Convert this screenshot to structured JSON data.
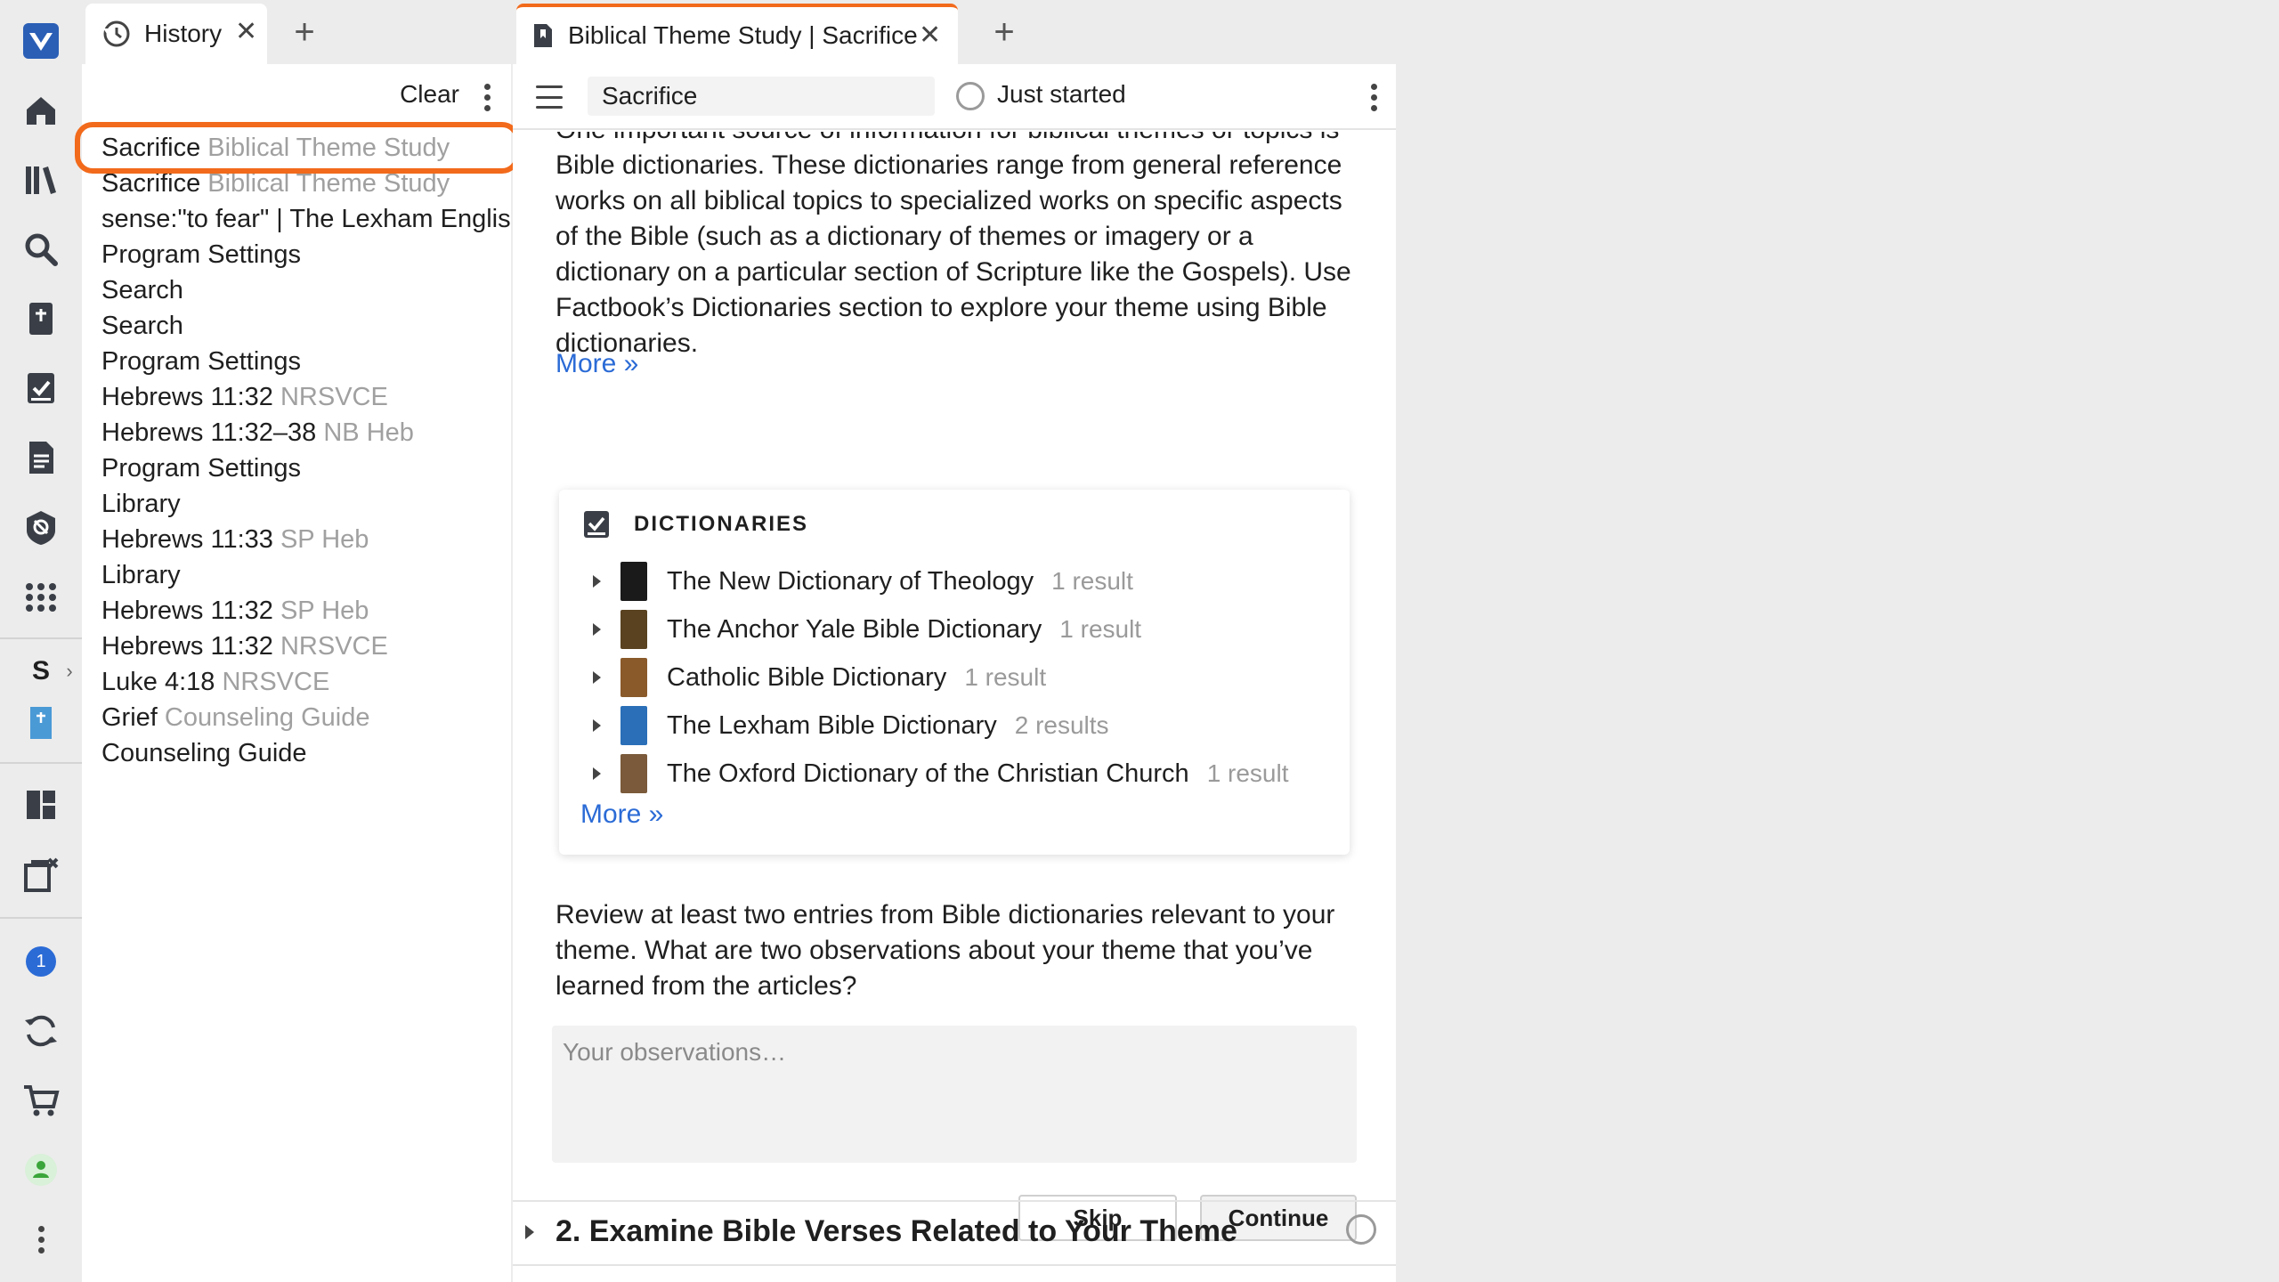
{
  "history_tab": {
    "label": "History",
    "close": "✕",
    "add": "+"
  },
  "history_toolbar": {
    "clear_label": "Clear"
  },
  "history_items": [
    {
      "title": "Sacrifice",
      "sub": "Biblical Theme Study"
    },
    {
      "title": "Sacrifice",
      "sub": "Biblical Theme Study"
    },
    {
      "title": "sense:\"to fear\" | The Lexham English",
      "sub": ""
    },
    {
      "title": "Program Settings",
      "sub": ""
    },
    {
      "title": "Search",
      "sub": ""
    },
    {
      "title": "Search",
      "sub": ""
    },
    {
      "title": "Program Settings",
      "sub": ""
    },
    {
      "title": "Hebrews 11:32",
      "sub": "NRSVCE"
    },
    {
      "title": "Hebrews 11:32–38",
      "sub": "NB Heb"
    },
    {
      "title": "Program Settings",
      "sub": ""
    },
    {
      "title": "Library",
      "sub": ""
    },
    {
      "title": "Hebrews 11:33",
      "sub": "SP Heb"
    },
    {
      "title": "Library",
      "sub": ""
    },
    {
      "title": "Hebrews 11:32",
      "sub": "SP Heb"
    },
    {
      "title": "Hebrews 11:32",
      "sub": "NRSVCE"
    },
    {
      "title": "Luke 4:18",
      "sub": "NRSVCE"
    },
    {
      "title": "Grief",
      "sub": "Counseling Guide"
    },
    {
      "title": "Counseling Guide",
      "sub": ""
    }
  ],
  "rail": {
    "shortcut_letter": "S",
    "notification_count": "1"
  },
  "doc_tab": {
    "label": "Biblical Theme Study | Sacrifice",
    "close": "✕",
    "add": "+"
  },
  "doc_toolbar": {
    "title_value": "Sacrifice",
    "status_label": "Just started"
  },
  "intro": {
    "cut_line": "One important source of information for biblical themes or topics is",
    "text": "Bible dictionaries. These dictionaries range from general reference works on all biblical topics to specialized works on specific aspects of the Bible (such as a dictionary of themes or imagery or a dictionary on a particular section of Scripture like the Gospels). Use Factbook’s Dictionaries section to explore your theme using Bible dictionaries.",
    "more": "More »"
  },
  "dictionaries": {
    "heading": "DICTIONARIES",
    "more": "More »",
    "items": [
      {
        "name": "The New Dictionary of Theology",
        "count": "1 result",
        "color": "#1a1a1a"
      },
      {
        "name": "The Anchor Yale Bible Dictionary",
        "count": "1 result",
        "color": "#5a4220"
      },
      {
        "name": "Catholic Bible Dictionary",
        "count": "1 result",
        "color": "#8a5a2a"
      },
      {
        "name": "The Lexham Bible Dictionary",
        "count": "2 results",
        "color": "#2a6fb8"
      },
      {
        "name": "The Oxford Dictionary of the Christian Church",
        "count": "1 result",
        "color": "#7a5a3a"
      }
    ]
  },
  "question": {
    "text": "Review at least two entries from Bible dictionaries relevant to your theme. What are two observations about your theme that you’ve learned from the articles?",
    "placeholder": "Your observations…"
  },
  "actions": {
    "skip": "Skip",
    "continue": "Continue"
  },
  "next_section": {
    "title": "2. Examine Bible Verses Related to Your Theme"
  },
  "colors": {
    "accent": "#f26a1b",
    "link": "#2b6bd6",
    "brand": "#2b5fb6"
  }
}
